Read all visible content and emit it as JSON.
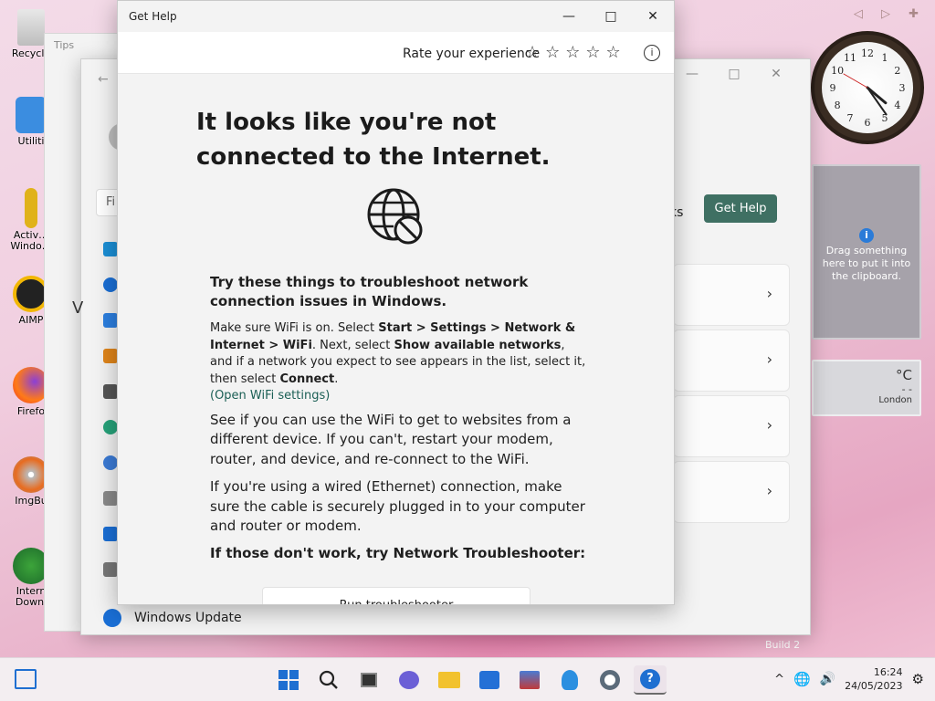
{
  "desktop": {
    "icons": [
      {
        "label": "Recycle"
      },
      {
        "label": "Utiliti"
      },
      {
        "label": "Activ… Windo…"
      },
      {
        "label": "AIMP"
      },
      {
        "label": "Firefo"
      },
      {
        "label": "ImgBu"
      },
      {
        "label": "Intern Downl"
      }
    ]
  },
  "gadgets": {
    "arrows": "◁ ▷ ✚",
    "clock_numerals": [
      "12",
      "1",
      "2",
      "3",
      "4",
      "5",
      "6",
      "7",
      "8",
      "9",
      "10",
      "11"
    ],
    "clipboard_message": "Drag something here to put it into the clipboard.",
    "weather": {
      "unit": "°C",
      "value": "- -",
      "city": "London"
    },
    "build": "Build 2"
  },
  "tips_window": {
    "title": "Tips"
  },
  "settings_window": {
    "search_partial": "Fi",
    "networks_fragment": "ks",
    "get_help_label": "Get Help",
    "side_letter": "V",
    "windows_update_label": "Windows Update"
  },
  "get_help_window": {
    "title": "Get Help",
    "rate_label": "Rate your experience",
    "stars": "☆☆☆☆☆",
    "info_glyph": "i",
    "heading": "It looks like you're not connected to the Internet.",
    "subheading": "Try these things to troubleshoot network connection issues in Windows.",
    "step1": {
      "t1": "Make sure WiFi is on. Select ",
      "b1": "Start > Settings > Network & Internet > WiFi",
      "t2": ". Next, select ",
      "b2": "Show available networks",
      "t3": ", and if a network you expect to see appears in the list, select it, then select ",
      "b3": "Connect",
      "t4": ".",
      "link": "(Open WiFi settings)"
    },
    "para2": "See if you can use the WiFi to get to websites from a different device. If you can't, restart your modem, router, and device, and re-connect to the WiFi.",
    "para3": "If you're using a wired (Ethernet) connection, make sure the cable is securely plugged in to your computer and router or modem.",
    "footer": "If those don't work, try Network Troubleshooter:",
    "run_button": "Run troubleshooter"
  },
  "taskbar": {
    "time": "16:24",
    "date": "24/05/2023",
    "tray_chevron": "^"
  },
  "colors": {
    "accent": "#3f7063",
    "link": "#1b5f55",
    "windows_blue": "#1f6fd1"
  }
}
